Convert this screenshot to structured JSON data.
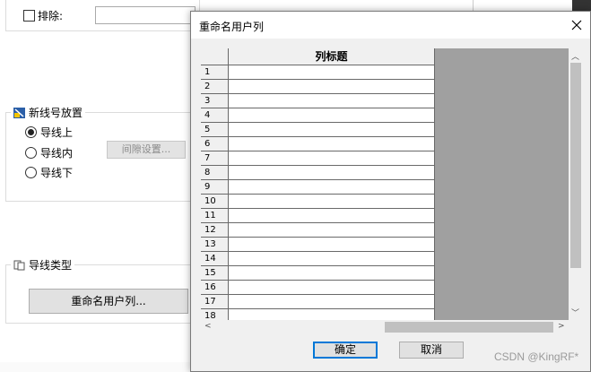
{
  "background": {
    "exclude_label": "排除:",
    "wire_group_title": "新线号放置",
    "radios": [
      {
        "label": "导线上",
        "checked": true
      },
      {
        "label": "导线内",
        "checked": false
      },
      {
        "label": "导线下",
        "checked": false
      }
    ],
    "gap_button": "间隙设置...",
    "type_group_title": "导线类型",
    "rename_button": "重命名用户列..."
  },
  "dialog": {
    "title": "重命名用户列",
    "column_header": "列标题",
    "rows": [
      "1",
      "2",
      "3",
      "4",
      "5",
      "6",
      "7",
      "8",
      "9",
      "10",
      "11",
      "12",
      "13",
      "14",
      "15",
      "16",
      "17",
      "18"
    ],
    "ok_label": "确定",
    "cancel_label": "取消"
  },
  "watermark": "CSDN @KingRF*"
}
